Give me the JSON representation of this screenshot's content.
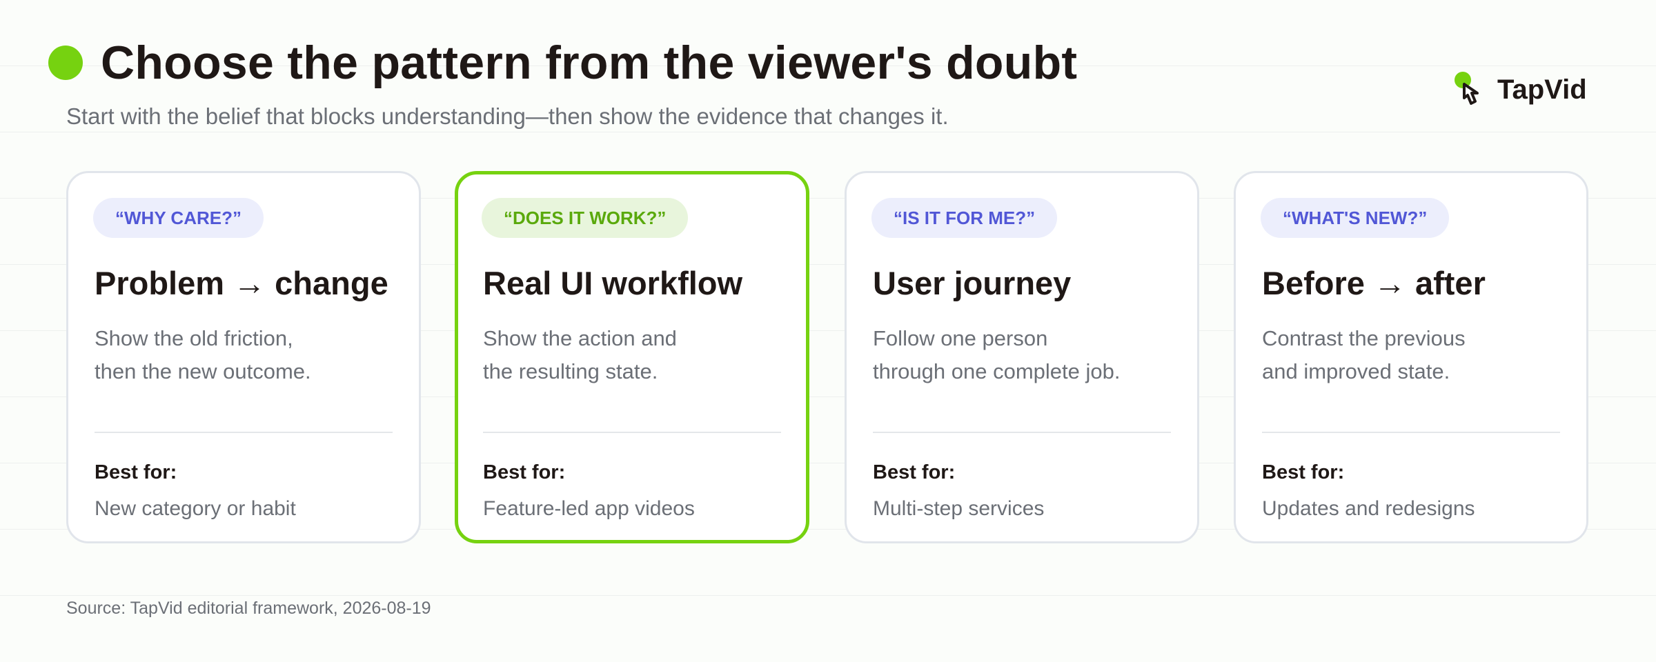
{
  "header": {
    "title": "Choose the pattern from the viewer's doubt",
    "subtitle": "Start with the belief that blocks understanding—then show the evidence that changes it."
  },
  "logo": {
    "text": "TapVid",
    "icon": "hand-pointer-icon",
    "accent": "#76d210"
  },
  "cards": [
    {
      "question": "“WHY CARE?”",
      "title": "Problem → change",
      "desc_lines": [
        "Show the old friction,",
        "then the new outcome."
      ],
      "best_label": "Best for:",
      "best_value": "New category or habit"
    },
    {
      "question": "“DOES IT WORK?”",
      "title": "Real UI workflow",
      "desc_lines": [
        "Show the action and",
        "the resulting state."
      ],
      "best_label": "Best for:",
      "best_value": "Feature-led app videos",
      "highlighted": true
    },
    {
      "question": "“IS IT FOR ME?”",
      "title": "User journey",
      "desc_lines": [
        "Follow one person",
        "through one complete job."
      ],
      "best_label": "Best for:",
      "best_value": "Multi-step services"
    },
    {
      "question": "“WHAT'S NEW?”",
      "title": "Before → after",
      "desc_lines": [
        "Contrast the previous",
        "and improved state."
      ],
      "best_label": "Best for:",
      "best_value": "Updates and redesigns"
    }
  ],
  "footer": {
    "source": "Source: TapVid editorial framework, 2026-08-19"
  },
  "colors": {
    "accent_green": "#76d210",
    "pill_text": "#5157d6",
    "pill_bg": "#eceefc",
    "title_text": "#1f1816",
    "muted_text": "#6b6f76",
    "card_border": "#e1e5eb"
  }
}
